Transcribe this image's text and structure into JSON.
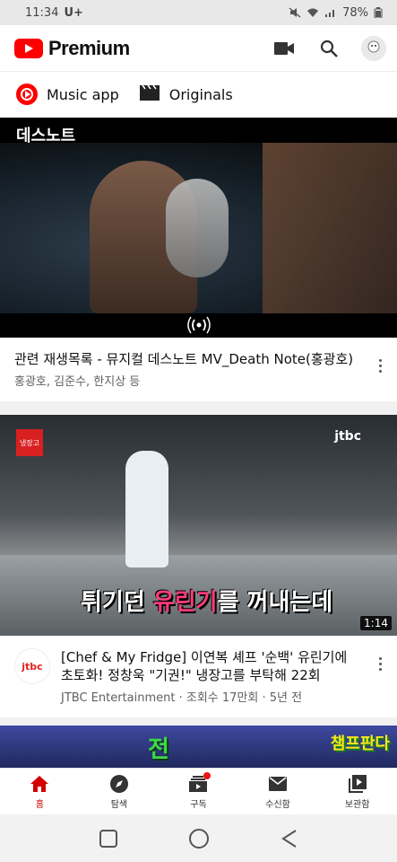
{
  "status": {
    "time": "11:34",
    "carrier_icon": "U+",
    "battery": "78%"
  },
  "appbar": {
    "logo_text": "Premium",
    "icons": [
      "camera-icon",
      "search-icon",
      "avatar"
    ]
  },
  "chips": [
    {
      "label": "Music app",
      "icon": "music-app-icon"
    },
    {
      "label": "Originals",
      "icon": "clapper-icon"
    }
  ],
  "videos": [
    {
      "thumb_tag": "데스노트",
      "title": "관련 재생목록 - 뮤지컬 데스노트 MV_Death Note(홍광호)",
      "subtitle": "홍광호, 김준수, 한지상 등"
    },
    {
      "overlay_text_prefix": "튀기던 ",
      "overlay_text_highlight": "유린기",
      "overlay_text_suffix": "를 꺼내는데",
      "duration": "1:14",
      "channel_avatar": "jtbc",
      "title": "[Chef & My Fridge] 이연복 셰프 '순백' 유린기에 초토화! 정창욱 \"기권!\"  냉장고를 부탁해 22회",
      "subtitle": "JTBC Entertainment · 조회수 17만회 · 5년 전"
    },
    {
      "thumb_text_left": "전",
      "thumb_text_right": "챔프판다"
    }
  ],
  "bottom_nav": [
    {
      "label": "홈",
      "icon": "home-icon",
      "active": true
    },
    {
      "label": "탐색",
      "icon": "compass-icon",
      "active": false
    },
    {
      "label": "구독",
      "icon": "subscriptions-icon",
      "active": false
    },
    {
      "label": "수신함",
      "icon": "inbox-icon",
      "active": false
    },
    {
      "label": "보관함",
      "icon": "library-icon",
      "active": false
    }
  ],
  "colors": {
    "brand_red": "#ff0000",
    "active_red": "#d20000",
    "text_secondary": "#606060"
  }
}
